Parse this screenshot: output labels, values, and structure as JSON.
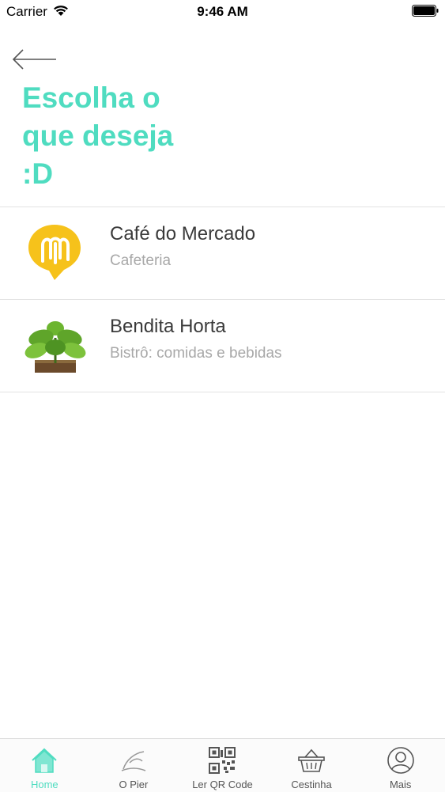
{
  "status_bar": {
    "carrier": "Carrier",
    "time": "9:46 AM"
  },
  "header": {
    "title_lines": [
      "Escolha o",
      "que deseja",
      ":D"
    ]
  },
  "stores": [
    {
      "name": "Café do Mercado",
      "category": "Cafeteria",
      "logo": "cafe-do-mercado-logo"
    },
    {
      "name": "Bendita Horta",
      "category": "Bistrô: comidas e bebidas",
      "logo": "bendita-horta-logo"
    }
  ],
  "tabs": [
    {
      "label": "Home",
      "icon": "home-icon",
      "active": true
    },
    {
      "label": "O Pier",
      "icon": "pier-icon",
      "active": false
    },
    {
      "label": "Ler QR Code",
      "icon": "qr-code-icon",
      "active": false
    },
    {
      "label": "Cestinha",
      "icon": "basket-icon",
      "active": false
    },
    {
      "label": "Mais",
      "icon": "user-icon",
      "active": false
    }
  ],
  "colors": {
    "accent": "#4fdcc0",
    "logo_yellow": "#f6c21b",
    "leaf_green": "#5fa52a"
  }
}
